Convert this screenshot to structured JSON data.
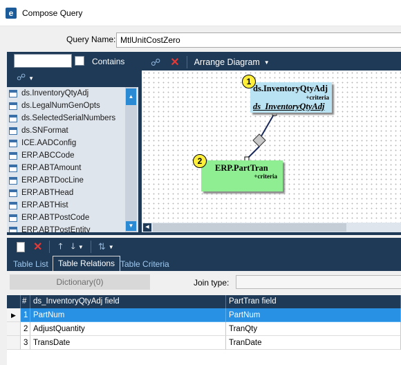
{
  "window": {
    "title": "Compose Query",
    "app_icon": "e"
  },
  "query": {
    "label": "Query Name:",
    "value": "MtlUnitCostZero"
  },
  "left_panel": {
    "search_value": "",
    "contains_label": "Contains",
    "contains_checked": false,
    "tables": [
      "ds.InventoryQtyAdj",
      "ds.LegalNumGenOpts",
      "ds.SelectedSerialNumbers",
      "ds.SNFormat",
      "ICE.AADConfig",
      "ERP.ABCCode",
      "ERP.ABTAmount",
      "ERP.ABTDocLine",
      "ERP.ABTHead",
      "ERP.ABTHist",
      "ERP.ABTPostCode",
      "ERP.ABTPostEntity"
    ]
  },
  "diagram_toolbar": {
    "arrange_label": "Arrange Diagram"
  },
  "diagram": {
    "nodes": [
      {
        "badge": "1",
        "title": "ds.InventoryQtyAdj",
        "criteria": "+criteria",
        "relation": "ds_InventoryQtyAdj",
        "color": "#b9e3f2"
      },
      {
        "badge": "2",
        "title": "ERP.PartTran",
        "criteria": "+criteria",
        "color": "#8fed92"
      }
    ]
  },
  "tabs": [
    {
      "label": "Table List",
      "active": false
    },
    {
      "label": "Table Relations",
      "active": true
    },
    {
      "label": "Table Criteria",
      "active": false
    }
  ],
  "relations": {
    "dictionary_label": "Dictionary(0)",
    "join_type_label": "Join type:",
    "join_type_value": "",
    "grid": {
      "headers": [
        "#",
        "ds_InventoryQtyAdj field",
        "PartTran field"
      ],
      "rows": [
        {
          "num": "1",
          "left": "PartNum",
          "right": "PartNum",
          "selected": true
        },
        {
          "num": "2",
          "left": "AdjustQuantity",
          "right": "TranQty",
          "selected": false
        },
        {
          "num": "3",
          "left": "TransDate",
          "right": "TranDate",
          "selected": false
        }
      ]
    }
  },
  "colors": {
    "panel_dark": "#1e3a57",
    "selection": "#2891e3",
    "delete_red": "#e53935",
    "badge_yellow": "#ffef3a"
  }
}
